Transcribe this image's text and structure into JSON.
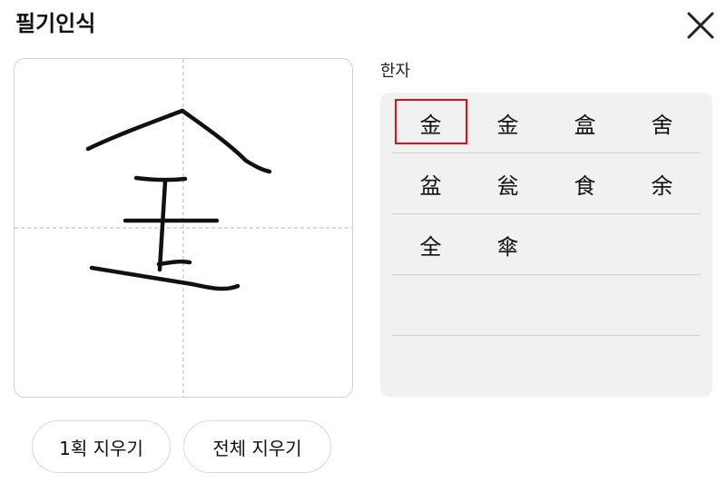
{
  "title": "필기인식",
  "panel_label": "한자",
  "candidates": [
    [
      "金",
      "金",
      "盒",
      "舍"
    ],
    [
      "盆",
      "瓮",
      "食",
      "余"
    ],
    [
      "全",
      "傘",
      "",
      ""
    ],
    [
      "",
      "",
      "",
      ""
    ],
    [
      "",
      "",
      "",
      ""
    ]
  ],
  "selected_candidate": "金",
  "buttons": {
    "undo_stroke": "1획 지우기",
    "clear_all": "전체 지우기"
  },
  "icons": {
    "close": "close-icon"
  },
  "colors": {
    "selection_border": "#e0101e",
    "results_background": "#f1f1f1"
  }
}
